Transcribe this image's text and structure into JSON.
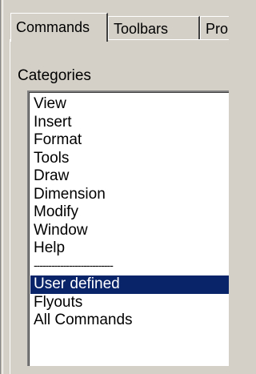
{
  "tabs": [
    {
      "label": "Commands",
      "active": true
    },
    {
      "label": "Toolbars",
      "active": false
    },
    {
      "label": "Pro",
      "active": false
    }
  ],
  "categories": {
    "label": "Categories",
    "items": [
      {
        "label": "View",
        "selected": false
      },
      {
        "label": "Insert",
        "selected": false
      },
      {
        "label": "Format",
        "selected": false
      },
      {
        "label": "Tools",
        "selected": false
      },
      {
        "label": "Draw",
        "selected": false
      },
      {
        "label": "Dimension",
        "selected": false
      },
      {
        "label": "Modify",
        "selected": false
      },
      {
        "label": "Window",
        "selected": false
      },
      {
        "label": "Help",
        "selected": false
      },
      {
        "label": "---------------------------",
        "selected": false,
        "separator": true
      },
      {
        "label": "User defined",
        "selected": true
      },
      {
        "label": "Flyouts",
        "selected": false
      },
      {
        "label": "All Commands",
        "selected": false
      }
    ]
  },
  "colors": {
    "face": "#d4d0c8",
    "selection": "#0a246a",
    "selection_text": "#ffffff"
  }
}
